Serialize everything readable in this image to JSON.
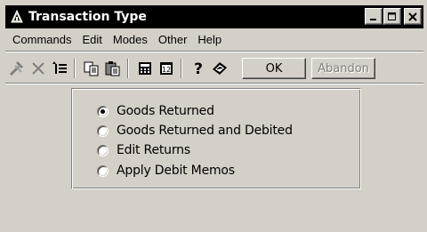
{
  "window": {
    "title": "Transaction Type"
  },
  "menu": {
    "items": [
      "Commands",
      "Edit",
      "Modes",
      "Other",
      "Help"
    ]
  },
  "toolbar": {
    "icons": [
      "hammer-icon",
      "delete-x-icon",
      "list-icon",
      "copy-icon",
      "paste-icon",
      "calculator-icon",
      "calendar-icon",
      "help-question-icon",
      "book-icon"
    ],
    "ok_label": "OK",
    "abandon_label": "Abandon"
  },
  "transaction_type": {
    "options": [
      {
        "label": "Goods Returned",
        "checked": true
      },
      {
        "label": "Goods Returned and Debited",
        "checked": false
      },
      {
        "label": "Edit Returns",
        "checked": false
      },
      {
        "label": "Apply Debit Memos",
        "checked": false
      }
    ]
  },
  "colors": {
    "face": "#d4d0c8",
    "titlebar": "#000000",
    "disabled_text": "#808080"
  }
}
